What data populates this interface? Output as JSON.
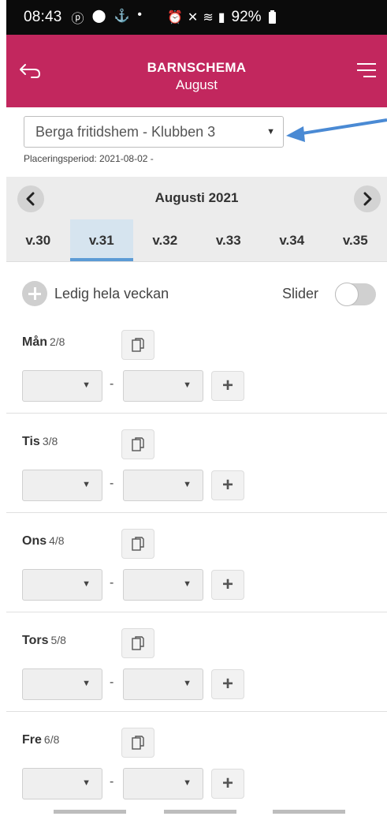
{
  "status_bar": {
    "time": "08:43",
    "battery": "92%",
    "left_icons": [
      "notification-icon",
      "location-icon",
      "usb-icon",
      "dot-icon"
    ],
    "right_icons": [
      "alarm-icon",
      "mute-icon",
      "wifi-icon",
      "volte-icon",
      "signal-icon"
    ]
  },
  "header": {
    "title": "BARNSCHEMA",
    "subtitle": "August",
    "color": "#c2275e"
  },
  "placement": {
    "selected": "Berga fritidshem - Klubben 3",
    "period": "Placeringsperiod: 2021-08-02 -"
  },
  "month_nav": {
    "label": "Augusti 2021"
  },
  "weeks": [
    {
      "label": "v.30",
      "active": false
    },
    {
      "label": "v.31",
      "active": true
    },
    {
      "label": "v.32",
      "active": false
    },
    {
      "label": "v.33",
      "active": false
    },
    {
      "label": "v.34",
      "active": false
    },
    {
      "label": "v.35",
      "active": false
    }
  ],
  "free_week": {
    "label": "Ledig hela veckan",
    "slider_label": "Slider",
    "slider_on": false
  },
  "days": [
    {
      "name": "Mån",
      "date": "2/8"
    },
    {
      "name": "Tis",
      "date": "3/8"
    },
    {
      "name": "Ons",
      "date": "4/8"
    },
    {
      "name": "Tors",
      "date": "5/8"
    },
    {
      "name": "Fre",
      "date": "6/8"
    }
  ],
  "time_separator": "-",
  "add_label": "+",
  "accent_color": "#5b9bd5"
}
